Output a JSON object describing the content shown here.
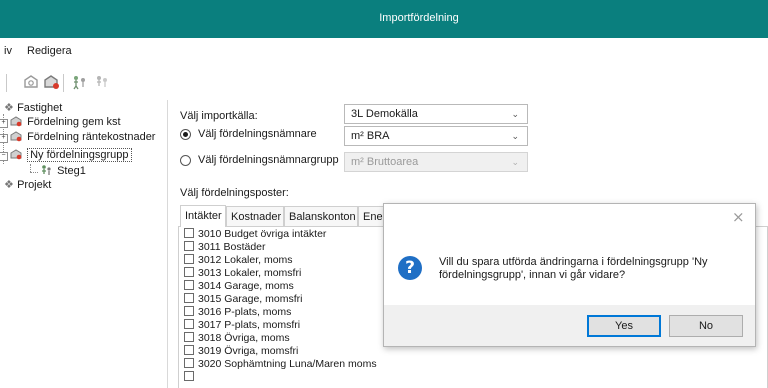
{
  "window": {
    "title": "Importfördelning",
    "accent": "#0a7f7e"
  },
  "menu": {
    "items": [
      "iv",
      "Redigera"
    ]
  },
  "toolbar": {
    "icons": [
      "building-gear-icon",
      "building-red-icon",
      "step-run-icon",
      "step-icon"
    ]
  },
  "tree": {
    "items": [
      {
        "label": "Fastighet",
        "icon": "building-icon"
      },
      {
        "label": "Fördelning gem kst",
        "icon": "distribution-icon"
      },
      {
        "label": "Fördelning räntekostnader",
        "icon": "distribution-icon"
      },
      {
        "label": "Ny fördelningsgrupp",
        "icon": "distribution-icon",
        "selected": true
      },
      {
        "label": "Steg1",
        "icon": "step-icon"
      },
      {
        "label": "Projekt",
        "icon": "project-icon"
      }
    ]
  },
  "form": {
    "source_label": "Välj importkälla:",
    "source_value": "3L Demokälla",
    "denominator_label": "Välj fördelningsnämnare",
    "denominator_value": "m² BRA",
    "denominator_selected": true,
    "group_label": "Välj fördelningsnämnargrupp",
    "group_value": "m² Bruttoarea",
    "posts_label": "Välj fördelningsposter:"
  },
  "tabs": [
    "Intäkter",
    "Kostnader",
    "Balanskonton",
    "Ener"
  ],
  "active_tab": 0,
  "posts": [
    "3010 Budget övriga intäkter",
    "3011 Bostäder",
    "3012 Lokaler, moms",
    "3013 Lokaler, momsfri",
    "3014 Garage, moms",
    "3015 Garage, momsfri",
    "3016 P-plats, moms",
    "3017 P-plats, momsfri",
    "3018 Övriga, moms",
    "3019 Övriga, momsfri",
    "3020 Sophämtning Luna/Maren moms"
  ],
  "dialog": {
    "close": "×",
    "message_line1": "Vill du spara utförda ändringarna i fördelningsgrupp 'Ny",
    "message_line2": "fördelningsgrupp', innan vi går vidare?",
    "yes": "Yes",
    "no": "No",
    "icon": "question-icon"
  }
}
